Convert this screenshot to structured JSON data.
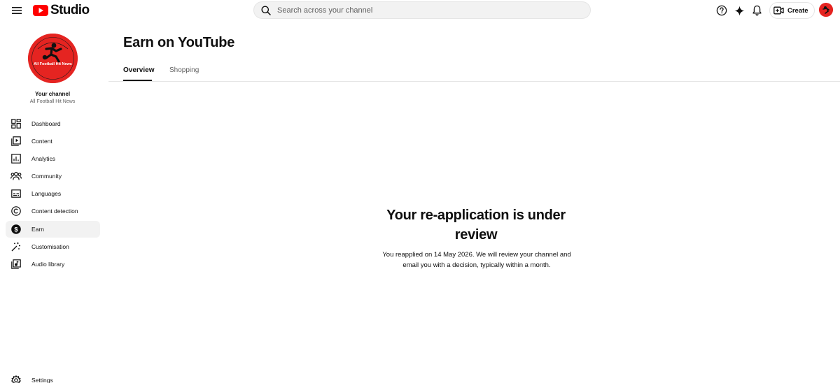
{
  "header": {
    "logo_text": "Studio",
    "search_placeholder": "Search across your channel",
    "create_label": "Create",
    "icons": [
      "menu-icon",
      "youtube-logo-icon",
      "search-icon",
      "help-icon",
      "sparkle-icon",
      "bell-icon",
      "create-video-icon",
      "account-avatar"
    ]
  },
  "channel": {
    "your_channel_label": "Your channel",
    "name": "All Football Hit News",
    "avatar_text": "All Football Hit News",
    "avatar_color": "#e52421"
  },
  "sidebar": {
    "items": [
      {
        "label": "Dashboard",
        "icon": "dashboard-icon"
      },
      {
        "label": "Content",
        "icon": "content-icon"
      },
      {
        "label": "Analytics",
        "icon": "analytics-icon"
      },
      {
        "label": "Community",
        "icon": "community-icon"
      },
      {
        "label": "Languages",
        "icon": "languages-icon"
      },
      {
        "label": "Content detection",
        "icon": "copyright-icon"
      },
      {
        "label": "Earn",
        "icon": "dollar-icon",
        "active": true
      },
      {
        "label": "Customisation",
        "icon": "magic-wand-icon"
      },
      {
        "label": "Audio library",
        "icon": "audio-library-icon"
      }
    ],
    "settings_label": "Settings"
  },
  "main": {
    "title": "Earn on YouTube",
    "tabs": [
      {
        "label": "Overview",
        "active": true
      },
      {
        "label": "Shopping",
        "active": false
      }
    ],
    "review": {
      "title": "Your re-application is under review",
      "description": "You reapplied on 14 May 2026. We will review your channel and email you with a decision, typically within a month."
    }
  },
  "colors": {
    "brand_red": "#ff0000",
    "text_primary": "#0f0f0f",
    "text_secondary": "#606060",
    "active_bg": "#f2f2f2"
  }
}
